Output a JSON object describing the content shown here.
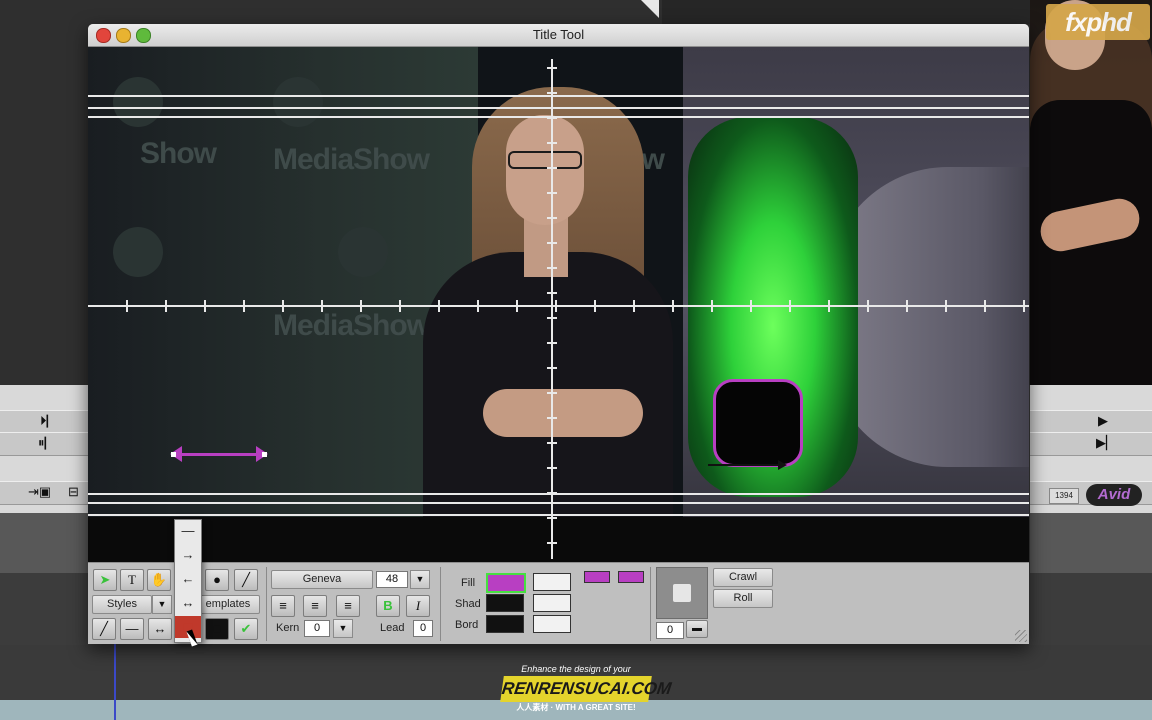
{
  "window": {
    "title": "Title Tool"
  },
  "branding": {
    "fxphd": "fxphd",
    "avid": "Avid",
    "badge": "1394"
  },
  "watermark": {
    "top": "Enhance the design of your",
    "main": "RENRENSUCAI.COM",
    "bottom": "人人素材 · WITH A GREAT SITE!"
  },
  "scene": {
    "logos": [
      "Show",
      "MediaShow",
      "Show",
      "MediaShow"
    ]
  },
  "tools": {
    "selection_icon": "arrow-pointer-icon",
    "text_icon": "T",
    "hand_icon": "✋",
    "oval_icon": "●",
    "line_icon": "╱",
    "styles_label": "Styles",
    "templates_label": "emplates",
    "line_style_icons": [
      "╱",
      "—",
      "↔",
      "■"
    ]
  },
  "arrow_popup": {
    "items": [
      "—",
      "→",
      "←",
      "↔",
      "◼"
    ]
  },
  "text": {
    "font": "Geneva",
    "size": "48",
    "kern_label": "Kern",
    "kern_value": "0",
    "lead_label": "Lead",
    "lead_value": "0",
    "bold_icon": "B",
    "italic_icon": "I"
  },
  "colors": {
    "fill_label": "Fill",
    "shad_label": "Shad",
    "bord_label": "Bord",
    "fill_color": "#b83fc2",
    "shad_color": "#111111",
    "bord_color": "#111111",
    "accent_magenta": "#b83fc2",
    "accent_green": "#6dff5c",
    "transparency_value": "0"
  },
  "motion": {
    "crawl_label": "Crawl",
    "roll_label": "Roll"
  },
  "editor": {
    "play_icon": "▶",
    "step_icon": "⏮"
  }
}
